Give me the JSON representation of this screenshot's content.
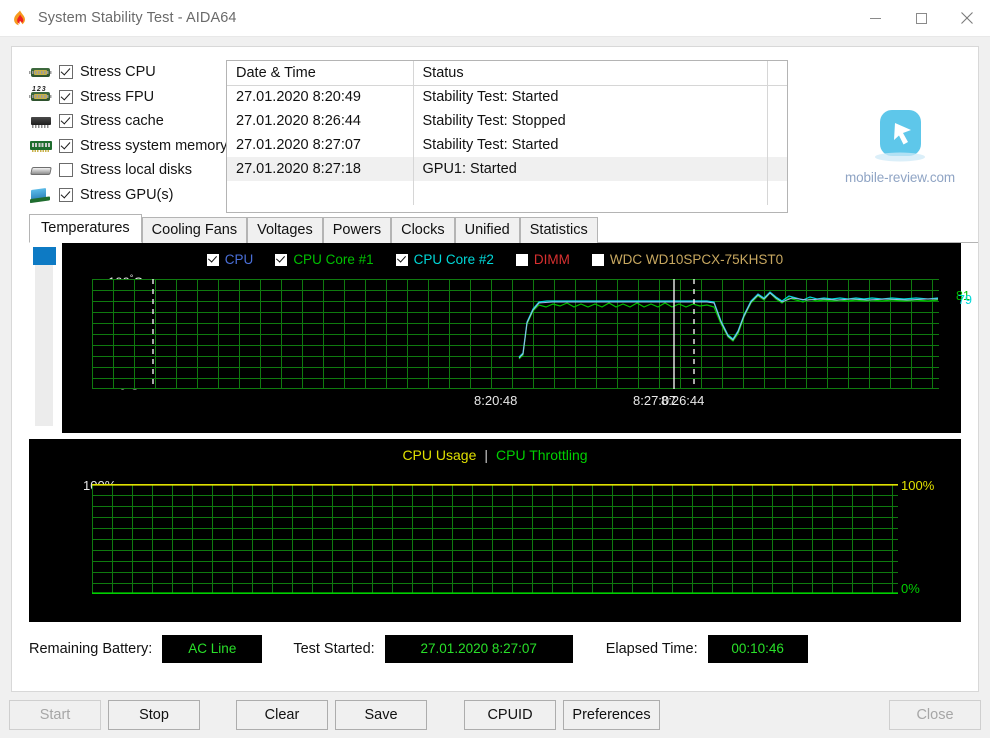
{
  "window": {
    "title": "System Stability Test - AIDA64",
    "app_icon": "flame-icon",
    "minimize": "minimize-icon",
    "maximize": "maximize-icon",
    "close": "close-icon"
  },
  "stress_options": [
    {
      "label": "Stress CPU",
      "checked": true,
      "icon": "cpu-chip-icon"
    },
    {
      "label": "Stress FPU",
      "checked": true,
      "icon": "fpu-chip-icon"
    },
    {
      "label": "Stress cache",
      "checked": true,
      "icon": "cache-chip-icon"
    },
    {
      "label": "Stress system memory",
      "checked": true,
      "icon": "memory-module-icon"
    },
    {
      "label": "Stress local disks",
      "checked": false,
      "icon": "hard-disk-icon"
    },
    {
      "label": "Stress GPU(s)",
      "checked": true,
      "icon": "gpu-card-icon"
    }
  ],
  "log": {
    "columns": [
      "Date & Time",
      "Status",
      ""
    ],
    "rows": [
      {
        "datetime": "27.01.2020 8:20:49",
        "status": "Stability Test: Started",
        "selected": false
      },
      {
        "datetime": "27.01.2020 8:26:44",
        "status": "Stability Test: Stopped",
        "selected": false
      },
      {
        "datetime": "27.01.2020 8:27:07",
        "status": "Stability Test: Started",
        "selected": false
      },
      {
        "datetime": "27.01.2020 8:27:18",
        "status": "GPU1: Started",
        "selected": true
      }
    ]
  },
  "watermark": {
    "text": "mobile-review.com"
  },
  "tabs": [
    {
      "label": "Temperatures",
      "active": true
    },
    {
      "label": "Cooling Fans",
      "active": false
    },
    {
      "label": "Voltages",
      "active": false
    },
    {
      "label": "Powers",
      "active": false
    },
    {
      "label": "Clocks",
      "active": false
    },
    {
      "label": "Unified",
      "active": false
    },
    {
      "label": "Statistics",
      "active": false
    }
  ],
  "temperature_chart": {
    "legend": [
      {
        "label": "CPU",
        "checked": true,
        "color": "#4a6fd8"
      },
      {
        "label": "CPU Core #1",
        "checked": true,
        "color": "#00c000"
      },
      {
        "label": "CPU Core #2",
        "checked": true,
        "color": "#00d8d8"
      },
      {
        "label": "DIMM",
        "checked": false,
        "color": "#d83030"
      },
      {
        "label": "WDC WD10SPCX-75KHST0",
        "checked": false,
        "color": "#c8a860"
      }
    ],
    "y_top": "100",
    "y_bottom": "0",
    "y_unit": "C",
    "x_ticks": [
      "8:20:48",
      "8:27:07",
      "8:26:44"
    ],
    "current_values": [
      {
        "label": "CPU",
        "value": "79",
        "color": "#c8d0e8"
      },
      {
        "label": "CPU Core #1",
        "value": "81",
        "color": "#00c000"
      },
      {
        "label": "CPU Core #2",
        "value": "79",
        "color": "#00d8d8"
      }
    ]
  },
  "usage_chart": {
    "title_usage": "CPU Usage",
    "title_separator": "|",
    "title_throttling": "CPU Throttling",
    "usage_color": "#e0e000",
    "throttling_color": "#00d000",
    "y_top_left": "100%",
    "y_bottom_left": "0%",
    "y_top_right": "100%",
    "y_bottom_right": "0%"
  },
  "status": {
    "battery_label": "Remaining Battery:",
    "battery_value": "AC Line",
    "started_label": "Test Started:",
    "started_value": "27.01.2020 8:27:07",
    "elapsed_label": "Elapsed Time:",
    "elapsed_value": "00:10:46"
  },
  "buttons": [
    {
      "label": "Start",
      "disabled": true
    },
    {
      "label": "Stop",
      "disabled": false
    },
    {
      "label": "Clear",
      "disabled": false
    },
    {
      "label": "Save",
      "disabled": false
    },
    {
      "label": "CPUID",
      "disabled": false
    },
    {
      "label": "Preferences",
      "disabled": false
    },
    {
      "label": "Close",
      "disabled": true
    }
  ],
  "chart_data": [
    {
      "type": "line",
      "title": "Temperatures",
      "xlabel": "",
      "ylabel": "C",
      "ylim": [
        0,
        100
      ],
      "grid": true,
      "legend_position": "top-center",
      "x_tick_labels": [
        "8:20:48",
        "8:27:07",
        "8:26:44"
      ],
      "annotations": [
        "solid white vertical marker",
        "dashed white vertical markers"
      ],
      "series": [
        {
          "name": "CPU",
          "color": "#4a6fd8",
          "values": [
            41,
            44,
            70,
            76,
            78,
            78,
            78,
            78,
            78,
            78,
            78,
            78,
            78,
            78,
            78,
            78,
            78,
            78,
            78,
            78,
            78,
            78,
            78,
            78,
            78,
            78,
            78,
            78,
            60,
            56,
            62,
            74,
            80,
            82,
            81,
            80,
            79,
            80,
            80,
            79,
            79,
            79,
            79,
            79,
            79,
            79
          ]
        },
        {
          "name": "CPU Core #1",
          "color": "#00c000",
          "values": [
            40,
            43,
            68,
            74,
            76,
            77,
            75,
            77,
            76,
            78,
            76,
            77,
            76,
            78,
            77,
            76,
            78,
            76,
            77,
            78,
            76,
            77,
            78,
            76,
            77,
            78,
            77,
            76,
            58,
            54,
            60,
            73,
            79,
            83,
            80,
            82,
            79,
            81,
            81,
            80,
            80,
            81,
            80,
            80,
            81,
            81
          ]
        },
        {
          "name": "CPU Core #2",
          "color": "#00d8d8",
          "values": [
            41,
            44,
            70,
            76,
            79,
            79,
            79,
            79,
            79,
            79,
            79,
            79,
            79,
            79,
            79,
            79,
            79,
            79,
            79,
            79,
            79,
            79,
            79,
            79,
            79,
            79,
            79,
            79,
            60,
            56,
            62,
            74,
            80,
            82,
            81,
            80,
            79,
            80,
            80,
            79,
            79,
            79,
            79,
            79,
            79,
            79
          ]
        }
      ]
    },
    {
      "type": "line",
      "title": "CPU Usage | CPU Throttling",
      "xlabel": "",
      "ylabel": "%",
      "ylim": [
        0,
        100
      ],
      "grid": true,
      "legend_position": "top-center",
      "series": [
        {
          "name": "CPU Usage",
          "color": "#e0e000",
          "values": [
            100,
            100,
            100,
            100,
            100,
            100,
            100,
            100,
            100,
            100,
            100,
            100,
            100,
            100,
            100,
            100,
            100,
            100,
            100,
            100,
            100,
            100,
            100,
            100,
            100,
            100,
            100,
            100,
            100,
            100,
            100,
            100,
            100,
            100,
            100,
            100,
            100,
            100,
            100,
            100,
            100,
            100,
            100,
            100,
            100,
            100
          ]
        },
        {
          "name": "CPU Throttling",
          "color": "#00d000",
          "values": [
            0,
            0,
            0,
            0,
            0,
            0,
            0,
            0,
            0,
            0,
            0,
            0,
            0,
            0,
            0,
            0,
            0,
            0,
            0,
            0,
            0,
            0,
            0,
            0,
            0,
            0,
            0,
            0,
            0,
            0,
            0,
            0,
            0,
            0,
            0,
            0,
            0,
            0,
            0,
            0,
            0,
            0,
            0,
            0,
            0,
            0
          ]
        }
      ]
    }
  ]
}
